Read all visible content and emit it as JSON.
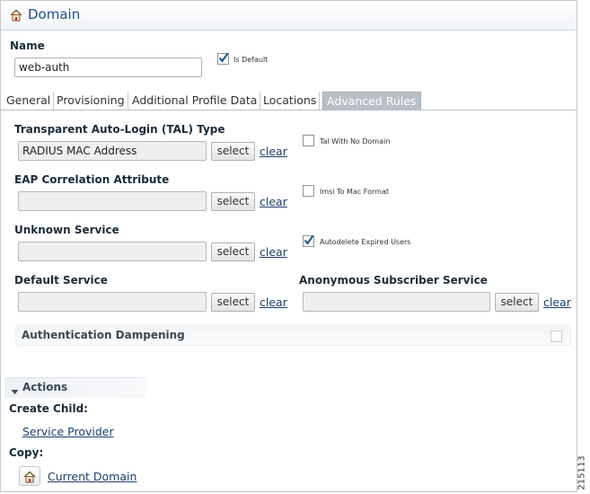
{
  "header": {
    "title": "Domain",
    "icon": "home-icon"
  },
  "name_section": {
    "label": "Name",
    "value": "web-auth",
    "is_default_label": "Is Default",
    "is_default_checked": true
  },
  "tabs": [
    {
      "label": "General",
      "active": false
    },
    {
      "label": "Provisioning",
      "active": false
    },
    {
      "label": "Additional Profile Data",
      "active": false
    },
    {
      "label": "Locations",
      "active": false
    },
    {
      "label": "Advanced Rules",
      "active": true
    }
  ],
  "fields": {
    "tal_type": {
      "label": "Transparent Auto-Login (TAL) Type",
      "value": "RADIUS MAC Address"
    },
    "eap": {
      "label": "EAP Correlation Attribute",
      "value": ""
    },
    "unknown_service": {
      "label": "Unknown Service",
      "value": ""
    },
    "default_service": {
      "label": "Default Service",
      "value": ""
    },
    "anonymous_service": {
      "label": "Anonymous Subscriber Service",
      "value": ""
    }
  },
  "buttons": {
    "select": "select",
    "clear": "clear"
  },
  "checkboxes": {
    "tal_with_no_domain": {
      "label": "Tal With No Domain",
      "checked": false
    },
    "imsi_to_mac": {
      "label": "Imsi To Mac Format",
      "checked": false
    },
    "autodelete": {
      "label": "Autodelete Expired Users",
      "checked": true
    }
  },
  "auth_dampening": {
    "label": "Authentication Dampening",
    "checked": false
  },
  "actions": {
    "header": "Actions",
    "create_child_label": "Create Child:",
    "create_child_link": "Service Provider",
    "copy_label": "Copy:",
    "copy_link": "Current Domain",
    "copy_icon": "home-icon"
  },
  "figure_number": "215113",
  "colors": {
    "title": "#1f4f86",
    "link": "#1b3f6c",
    "active_tab": "#b9bfc6"
  }
}
